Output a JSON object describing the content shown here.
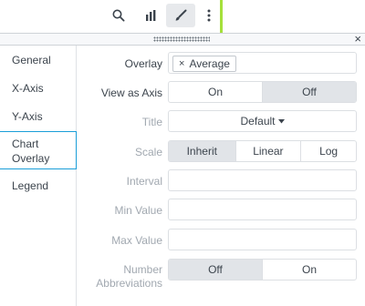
{
  "toolbar": {
    "icons": [
      "search-icon",
      "bar-chart-icon",
      "paintbrush-icon",
      "more-vertical-icon"
    ],
    "accent_color": "#a5e03b"
  },
  "panel": {
    "close_glyph": "×"
  },
  "nav": {
    "items": [
      {
        "label": "General"
      },
      {
        "label": "X-Axis"
      },
      {
        "label": "Y-Axis"
      },
      {
        "label": "Chart Overlay",
        "active": true
      },
      {
        "label": "Legend"
      }
    ]
  },
  "form": {
    "overlay": {
      "label": "Overlay",
      "chip": "Average",
      "chip_remove": "×"
    },
    "view_as_axis": {
      "label": "View as Axis",
      "options": [
        "On",
        "Off"
      ],
      "selected": "Off"
    },
    "title": {
      "label": "Title",
      "value": "Default"
    },
    "scale": {
      "label": "Scale",
      "options": [
        "Inherit",
        "Linear",
        "Log"
      ],
      "selected": "Inherit"
    },
    "interval": {
      "label": "Interval",
      "value": ""
    },
    "min_value": {
      "label": "Min Value",
      "value": ""
    },
    "max_value": {
      "label": "Max Value",
      "value": ""
    },
    "number_abbreviations": {
      "label_line1": "Number",
      "label_line2": "Abbreviations",
      "options": [
        "Off",
        "On"
      ],
      "selected": "Off"
    }
  }
}
